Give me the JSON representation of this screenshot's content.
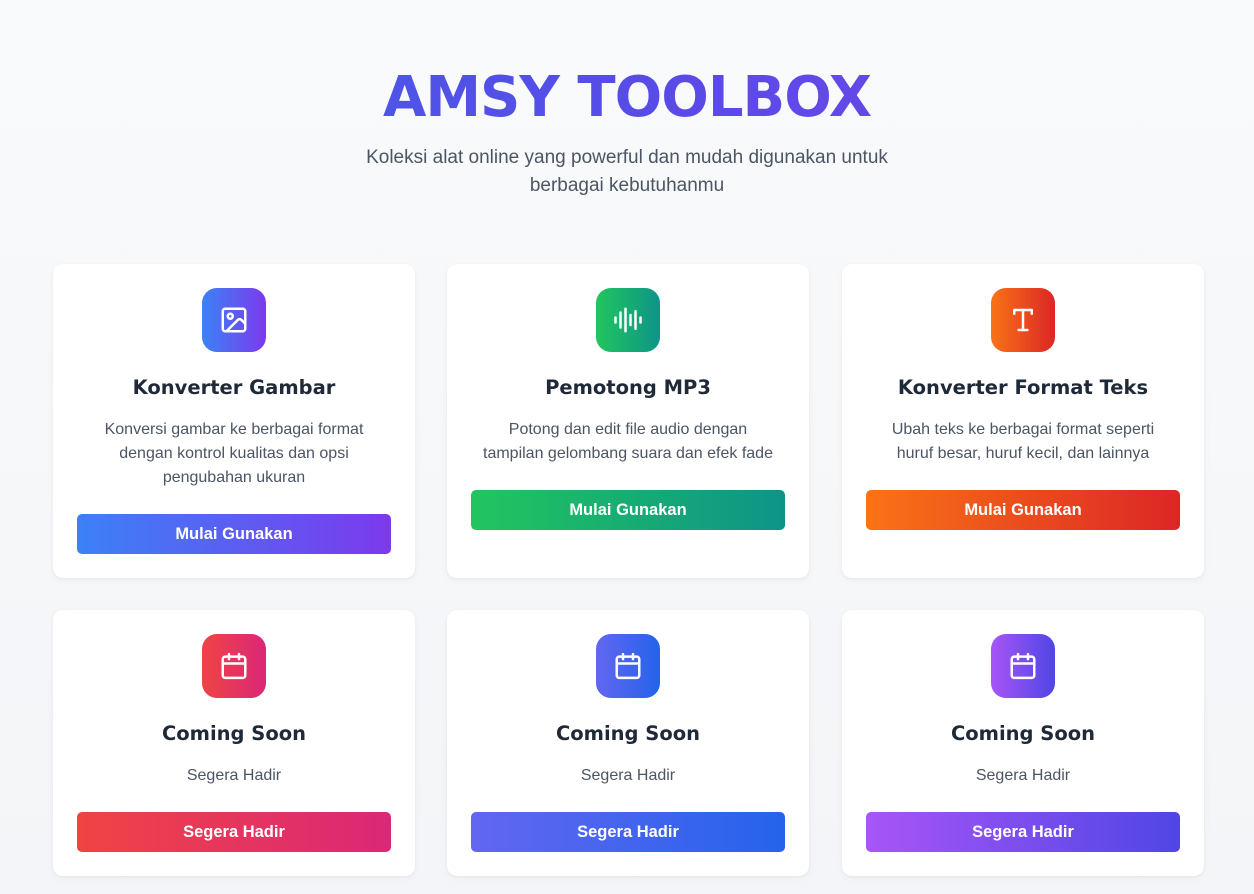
{
  "header": {
    "title": "AMSY TOOLBOX",
    "subtitle": "Koleksi alat online yang powerful dan mudah digunakan untuk berbagai kebutuhanmu"
  },
  "tools": [
    {
      "title": "Konverter Gambar",
      "description": "Konversi gambar ke berbagai format dengan kontrol kualitas dan opsi pengubahan ukuran",
      "button_label": "Mulai Gunakan",
      "icon": "image-icon",
      "colors": [
        "#3b82f6",
        "#7c3aed"
      ]
    },
    {
      "title": "Pemotong MP3",
      "description": "Potong dan edit file audio dengan tampilan gelombang suara dan efek fade",
      "button_label": "Mulai Gunakan",
      "icon": "audio-waveform-icon",
      "colors": [
        "#22c55e",
        "#0d9488"
      ]
    },
    {
      "title": "Konverter Format Teks",
      "description": "Ubah teks ke berbagai format seperti huruf besar, huruf kecil, dan lainnya",
      "button_label": "Mulai Gunakan",
      "icon": "text-icon",
      "colors": [
        "#f97316",
        "#dc2626"
      ]
    }
  ],
  "coming_soon": [
    {
      "title": "Coming Soon",
      "description": "Segera Hadir",
      "button_label": "Segera Hadir",
      "icon": "calendar-icon",
      "colors": [
        "#ef4444",
        "#db2777"
      ]
    },
    {
      "title": "Coming Soon",
      "description": "Segera Hadir",
      "button_label": "Segera Hadir",
      "icon": "calendar-icon",
      "colors": [
        "#6366f1",
        "#2563eb"
      ]
    },
    {
      "title": "Coming Soon",
      "description": "Segera Hadir",
      "button_label": "Segera Hadir",
      "icon": "calendar-icon",
      "colors": [
        "#a855f7",
        "#4f46e5"
      ]
    }
  ]
}
